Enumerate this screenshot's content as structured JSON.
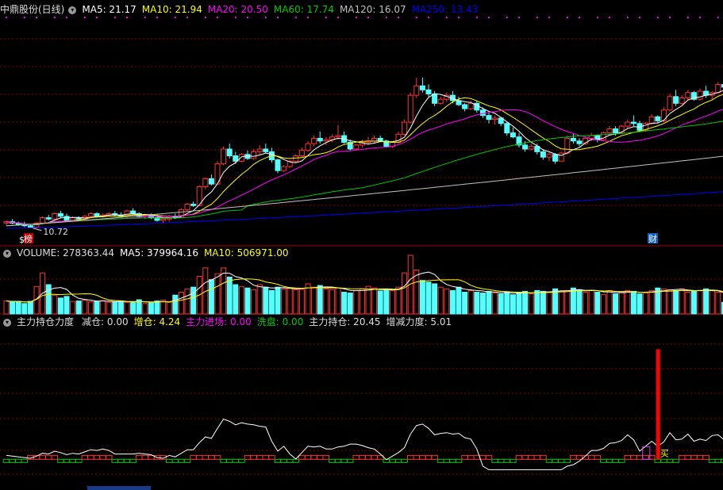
{
  "colors": {
    "bg": "#000000",
    "grid": "#8b0000",
    "rise": "#ff3232",
    "fall": "#54ffff",
    "ma5": "#ffffff",
    "ma10": "#ffff00",
    "ma20": "#ff00ff",
    "ma60": "#00c800",
    "ma120": "#c0c0c0",
    "ma250": "#0000ff",
    "label": "#dddddd"
  },
  "price_panel": {
    "title": "中鼎股份(日线)",
    "ma_labels": [
      {
        "key": "ma5",
        "text": "MA5: 21.17"
      },
      {
        "key": "ma10",
        "text": "MA10: 21.94"
      },
      {
        "key": "ma20",
        "text": "MA20: 20.50"
      },
      {
        "key": "ma60",
        "text": "MA60: 17.74"
      },
      {
        "key": "ma120",
        "text": "MA120: 16.07"
      },
      {
        "key": "ma250",
        "text": "MA250: 13.43"
      }
    ],
    "low_marker": "10.72",
    "badge_left": "榜",
    "badge_left_prefix": "$",
    "badge_right": "财"
  },
  "volume_panel": {
    "labels": [
      {
        "key": "ma5",
        "text": "VOLUME: 278363.44"
      },
      {
        "key": "ma5",
        "text": "MA5: 379964.16"
      },
      {
        "key": "ma10",
        "text": "MA10: 506971.00"
      }
    ]
  },
  "indicator_panel": {
    "title": "主力持仓力度",
    "labels": [
      {
        "key": "label",
        "text": "减仓: 0.00"
      },
      {
        "key": "ma10",
        "text": "增仓: 4.24"
      },
      {
        "key": "ma20",
        "text": "主力进场: 0.00"
      },
      {
        "key": "ma60",
        "text": "洗盘: 0.00"
      },
      {
        "key": "label",
        "text": "主力持仓: 20.45"
      },
      {
        "key": "label",
        "text": "增减力度: 5.01"
      }
    ],
    "buy_marker": "买"
  },
  "chart_data": [
    {
      "type": "candlestick",
      "title": "中鼎股份(日线)",
      "ylim": [
        10,
        26.5
      ],
      "candles": [
        [
          11.1,
          11.3,
          10.9,
          11.2
        ],
        [
          11.2,
          11.4,
          11.0,
          11.1
        ],
        [
          11.1,
          11.2,
          10.9,
          11.0
        ],
        [
          11.0,
          11.2,
          10.8,
          10.9
        ],
        [
          10.9,
          11.0,
          10.72,
          10.8
        ],
        [
          10.8,
          11.2,
          10.8,
          11.1
        ],
        [
          11.1,
          11.6,
          11.0,
          11.5
        ],
        [
          11.5,
          11.7,
          11.3,
          11.4
        ],
        [
          11.4,
          11.9,
          11.3,
          11.8
        ],
        [
          11.8,
          12.0,
          11.5,
          11.6
        ],
        [
          11.6,
          11.8,
          11.2,
          11.3
        ],
        [
          11.3,
          11.6,
          11.2,
          11.5
        ],
        [
          11.5,
          11.6,
          11.3,
          11.4
        ],
        [
          11.4,
          11.7,
          11.3,
          11.6
        ],
        [
          11.6,
          11.9,
          11.5,
          11.8
        ],
        [
          11.8,
          11.9,
          11.5,
          11.6
        ],
        [
          11.6,
          11.8,
          11.5,
          11.7
        ],
        [
          11.7,
          11.9,
          11.6,
          11.8
        ],
        [
          11.8,
          12.0,
          11.6,
          11.7
        ],
        [
          11.7,
          11.9,
          11.5,
          11.6
        ],
        [
          11.6,
          12.1,
          11.5,
          12.0
        ],
        [
          12.0,
          12.2,
          11.7,
          11.8
        ],
        [
          11.8,
          11.9,
          11.5,
          11.6
        ],
        [
          11.6,
          11.8,
          11.4,
          11.7
        ],
        [
          11.7,
          11.8,
          11.4,
          11.5
        ],
        [
          11.5,
          11.8,
          11.2,
          11.3
        ],
        [
          11.3,
          11.5,
          11.1,
          11.4
        ],
        [
          11.4,
          11.7,
          11.2,
          11.6
        ],
        [
          11.6,
          11.8,
          11.4,
          11.5
        ],
        [
          11.5,
          12.2,
          11.5,
          12.1
        ],
        [
          12.1,
          12.6,
          12.0,
          12.5
        ],
        [
          12.5,
          12.7,
          12.3,
          12.4
        ],
        [
          12.4,
          13.9,
          12.4,
          13.8
        ],
        [
          13.8,
          14.5,
          13.6,
          14.4
        ],
        [
          14.4,
          14.7,
          13.9,
          14.0
        ],
        [
          14.0,
          15.7,
          14.0,
          15.5
        ],
        [
          15.5,
          16.8,
          15.4,
          16.6
        ],
        [
          16.6,
          17.0,
          15.9,
          16.1
        ],
        [
          16.1,
          16.4,
          15.5,
          15.7
        ],
        [
          15.7,
          16.3,
          15.6,
          16.2
        ],
        [
          16.2,
          16.5,
          15.8,
          15.9
        ],
        [
          15.9,
          16.6,
          15.8,
          16.4
        ],
        [
          16.4,
          16.9,
          16.2,
          16.6
        ],
        [
          16.6,
          17.0,
          16.3,
          16.4
        ],
        [
          16.4,
          16.7,
          15.6,
          15.8
        ],
        [
          15.8,
          15.9,
          14.8,
          15.0
        ],
        [
          15.0,
          15.4,
          14.9,
          15.3
        ],
        [
          15.3,
          15.8,
          15.2,
          15.7
        ],
        [
          15.7,
          16.2,
          15.6,
          16.1
        ],
        [
          16.1,
          16.7,
          16.0,
          16.5
        ],
        [
          16.5,
          17.2,
          16.4,
          17.0
        ],
        [
          17.0,
          17.6,
          16.8,
          17.4
        ],
        [
          17.4,
          17.9,
          17.0,
          17.2
        ],
        [
          17.2,
          17.5,
          16.9,
          17.3
        ],
        [
          17.3,
          17.7,
          17.1,
          17.5
        ],
        [
          17.5,
          18.4,
          17.3,
          17.6
        ],
        [
          17.6,
          17.9,
          17.0,
          17.1
        ],
        [
          17.1,
          17.3,
          16.5,
          16.6
        ],
        [
          16.6,
          17.0,
          16.5,
          16.9
        ],
        [
          16.9,
          17.3,
          16.7,
          17.1
        ],
        [
          17.1,
          17.5,
          16.9,
          17.2
        ],
        [
          17.2,
          17.6,
          17.0,
          17.4
        ],
        [
          17.4,
          17.6,
          17.1,
          17.2
        ],
        [
          17.2,
          17.3,
          16.7,
          16.8
        ],
        [
          16.8,
          17.2,
          16.7,
          17.1
        ],
        [
          17.1,
          17.9,
          17.0,
          17.7
        ],
        [
          17.7,
          18.8,
          17.6,
          18.6
        ],
        [
          18.6,
          20.8,
          18.5,
          20.6
        ],
        [
          20.6,
          21.9,
          20.4,
          21.3
        ],
        [
          21.3,
          21.9,
          20.8,
          21.0
        ],
        [
          21.0,
          21.4,
          20.5,
          20.7
        ],
        [
          20.7,
          20.9,
          19.8,
          20.0
        ],
        [
          20.0,
          20.5,
          19.9,
          20.3
        ],
        [
          20.3,
          20.8,
          20.1,
          20.6
        ],
        [
          20.6,
          20.9,
          20.0,
          20.2
        ],
        [
          20.2,
          20.5,
          19.8,
          19.9
        ],
        [
          19.9,
          20.0,
          19.4,
          19.6
        ],
        [
          19.6,
          20.2,
          19.5,
          20.0
        ],
        [
          20.0,
          20.2,
          19.3,
          19.5
        ],
        [
          19.5,
          19.7,
          18.9,
          19.1
        ],
        [
          19.1,
          19.3,
          18.5,
          18.8
        ],
        [
          18.8,
          19.1,
          18.4,
          18.9
        ],
        [
          18.9,
          19.0,
          18.3,
          18.5
        ],
        [
          18.5,
          18.6,
          17.6,
          17.8
        ],
        [
          17.8,
          18.2,
          17.4,
          17.5
        ],
        [
          17.5,
          17.8,
          16.7,
          16.9
        ],
        [
          16.9,
          17.2,
          16.4,
          16.6
        ],
        [
          16.6,
          17.0,
          16.5,
          16.8
        ],
        [
          16.8,
          17.0,
          16.2,
          16.4
        ],
        [
          16.4,
          16.6,
          15.8,
          16.0
        ],
        [
          16.0,
          16.4,
          15.7,
          16.2
        ],
        [
          16.2,
          16.3,
          15.5,
          15.7
        ],
        [
          15.7,
          16.4,
          15.7,
          16.3
        ],
        [
          16.3,
          17.6,
          16.2,
          17.4
        ],
        [
          17.4,
          17.8,
          17.0,
          17.2
        ],
        [
          17.2,
          17.4,
          16.8,
          17.0
        ],
        [
          17.0,
          17.5,
          16.9,
          17.4
        ],
        [
          17.4,
          17.8,
          17.2,
          17.6
        ],
        [
          17.6,
          17.7,
          17.1,
          17.3
        ],
        [
          17.3,
          17.9,
          17.2,
          17.8
        ],
        [
          17.8,
          18.3,
          17.7,
          18.1
        ],
        [
          18.1,
          18.3,
          17.6,
          17.8
        ],
        [
          17.8,
          18.4,
          17.7,
          18.3
        ],
        [
          18.3,
          18.8,
          18.1,
          18.6
        ],
        [
          18.6,
          19.1,
          18.3,
          18.5
        ],
        [
          18.5,
          18.7,
          17.9,
          18.0
        ],
        [
          18.0,
          18.6,
          17.9,
          18.5
        ],
        [
          18.5,
          19.2,
          18.4,
          19.0
        ],
        [
          19.0,
          19.1,
          18.5,
          18.7
        ],
        [
          18.7,
          19.7,
          18.6,
          19.5
        ],
        [
          19.5,
          20.7,
          19.4,
          20.5
        ],
        [
          20.5,
          21.0,
          19.8,
          20.0
        ],
        [
          20.0,
          20.6,
          19.9,
          20.4
        ],
        [
          20.4,
          21.0,
          20.2,
          20.8
        ],
        [
          20.8,
          20.9,
          20.2,
          20.3
        ],
        [
          20.3,
          21.1,
          20.2,
          20.9
        ],
        [
          20.9,
          21.3,
          20.4,
          20.6
        ],
        [
          20.6,
          20.9,
          20.3,
          20.8
        ],
        [
          20.8,
          21.6,
          20.7,
          21.4
        ],
        [
          21.4,
          22.8,
          20.3,
          21.2
        ]
      ],
      "series": [
        {
          "name": "MA5",
          "key": "ma5",
          "last": 21.17
        },
        {
          "name": "MA10",
          "key": "ma10",
          "last": 21.94
        },
        {
          "name": "MA20",
          "key": "ma20",
          "last": 20.5
        },
        {
          "name": "MA60",
          "key": "ma60",
          "last": 17.74
        },
        {
          "name": "MA120",
          "key": "ma120",
          "last": 16.07
        },
        {
          "name": "MA250",
          "key": "ma250",
          "last": 13.43
        }
      ]
    },
    {
      "type": "bar",
      "title": "VOLUME",
      "ylim": [
        0,
        1400000
      ],
      "values": [
        310000,
        290000,
        300000,
        250000,
        300000,
        650000,
        980000,
        700000,
        450000,
        380000,
        420000,
        300000,
        310000,
        330000,
        290000,
        300000,
        320000,
        280000,
        290000,
        310000,
        280000,
        270000,
        340000,
        250000,
        260000,
        310000,
        330000,
        280000,
        450000,
        520000,
        600000,
        640000,
        900000,
        1100000,
        820000,
        960000,
        1100000,
        880000,
        700000,
        650000,
        620000,
        580000,
        700000,
        640000,
        560000,
        640000,
        600000,
        620000,
        580000,
        590000,
        720000,
        640000,
        680000,
        600000,
        580000,
        620000,
        520000,
        500000,
        560000,
        600000,
        660000,
        620000,
        550000,
        580000,
        560000,
        640000,
        980000,
        1400000,
        1050000,
        800000,
        760000,
        720000,
        640000,
        600000,
        560000,
        640000,
        520000,
        560000,
        520000,
        500000,
        540000,
        500000,
        480000,
        520000,
        460000,
        520000,
        540000,
        480000,
        560000,
        540000,
        520000,
        600000,
        540000,
        560000,
        620000,
        580000,
        520000,
        560000,
        520000,
        460000,
        560000,
        480000,
        520000,
        560000,
        540000,
        480000,
        500000,
        560000,
        620000,
        600000,
        580000,
        560000,
        600000,
        520000,
        540000,
        560000,
        600000,
        560000,
        520000,
        278363
      ],
      "series": [
        {
          "name": "MA5",
          "key": "ma5",
          "last": 379964.16
        },
        {
          "name": "MA10",
          "key": "ma10",
          "last": 506971.0
        }
      ]
    },
    {
      "type": "line",
      "title": "主力持仓力度",
      "ylim": [
        -2,
        10
      ],
      "buy_index": 108,
      "buy_value": 8.5,
      "series": [
        {
          "name": "主力持仓",
          "key": "ma5",
          "last": 20.45
        },
        {
          "name": "增减力度",
          "key": "ma10",
          "last": 5.01
        }
      ]
    }
  ]
}
